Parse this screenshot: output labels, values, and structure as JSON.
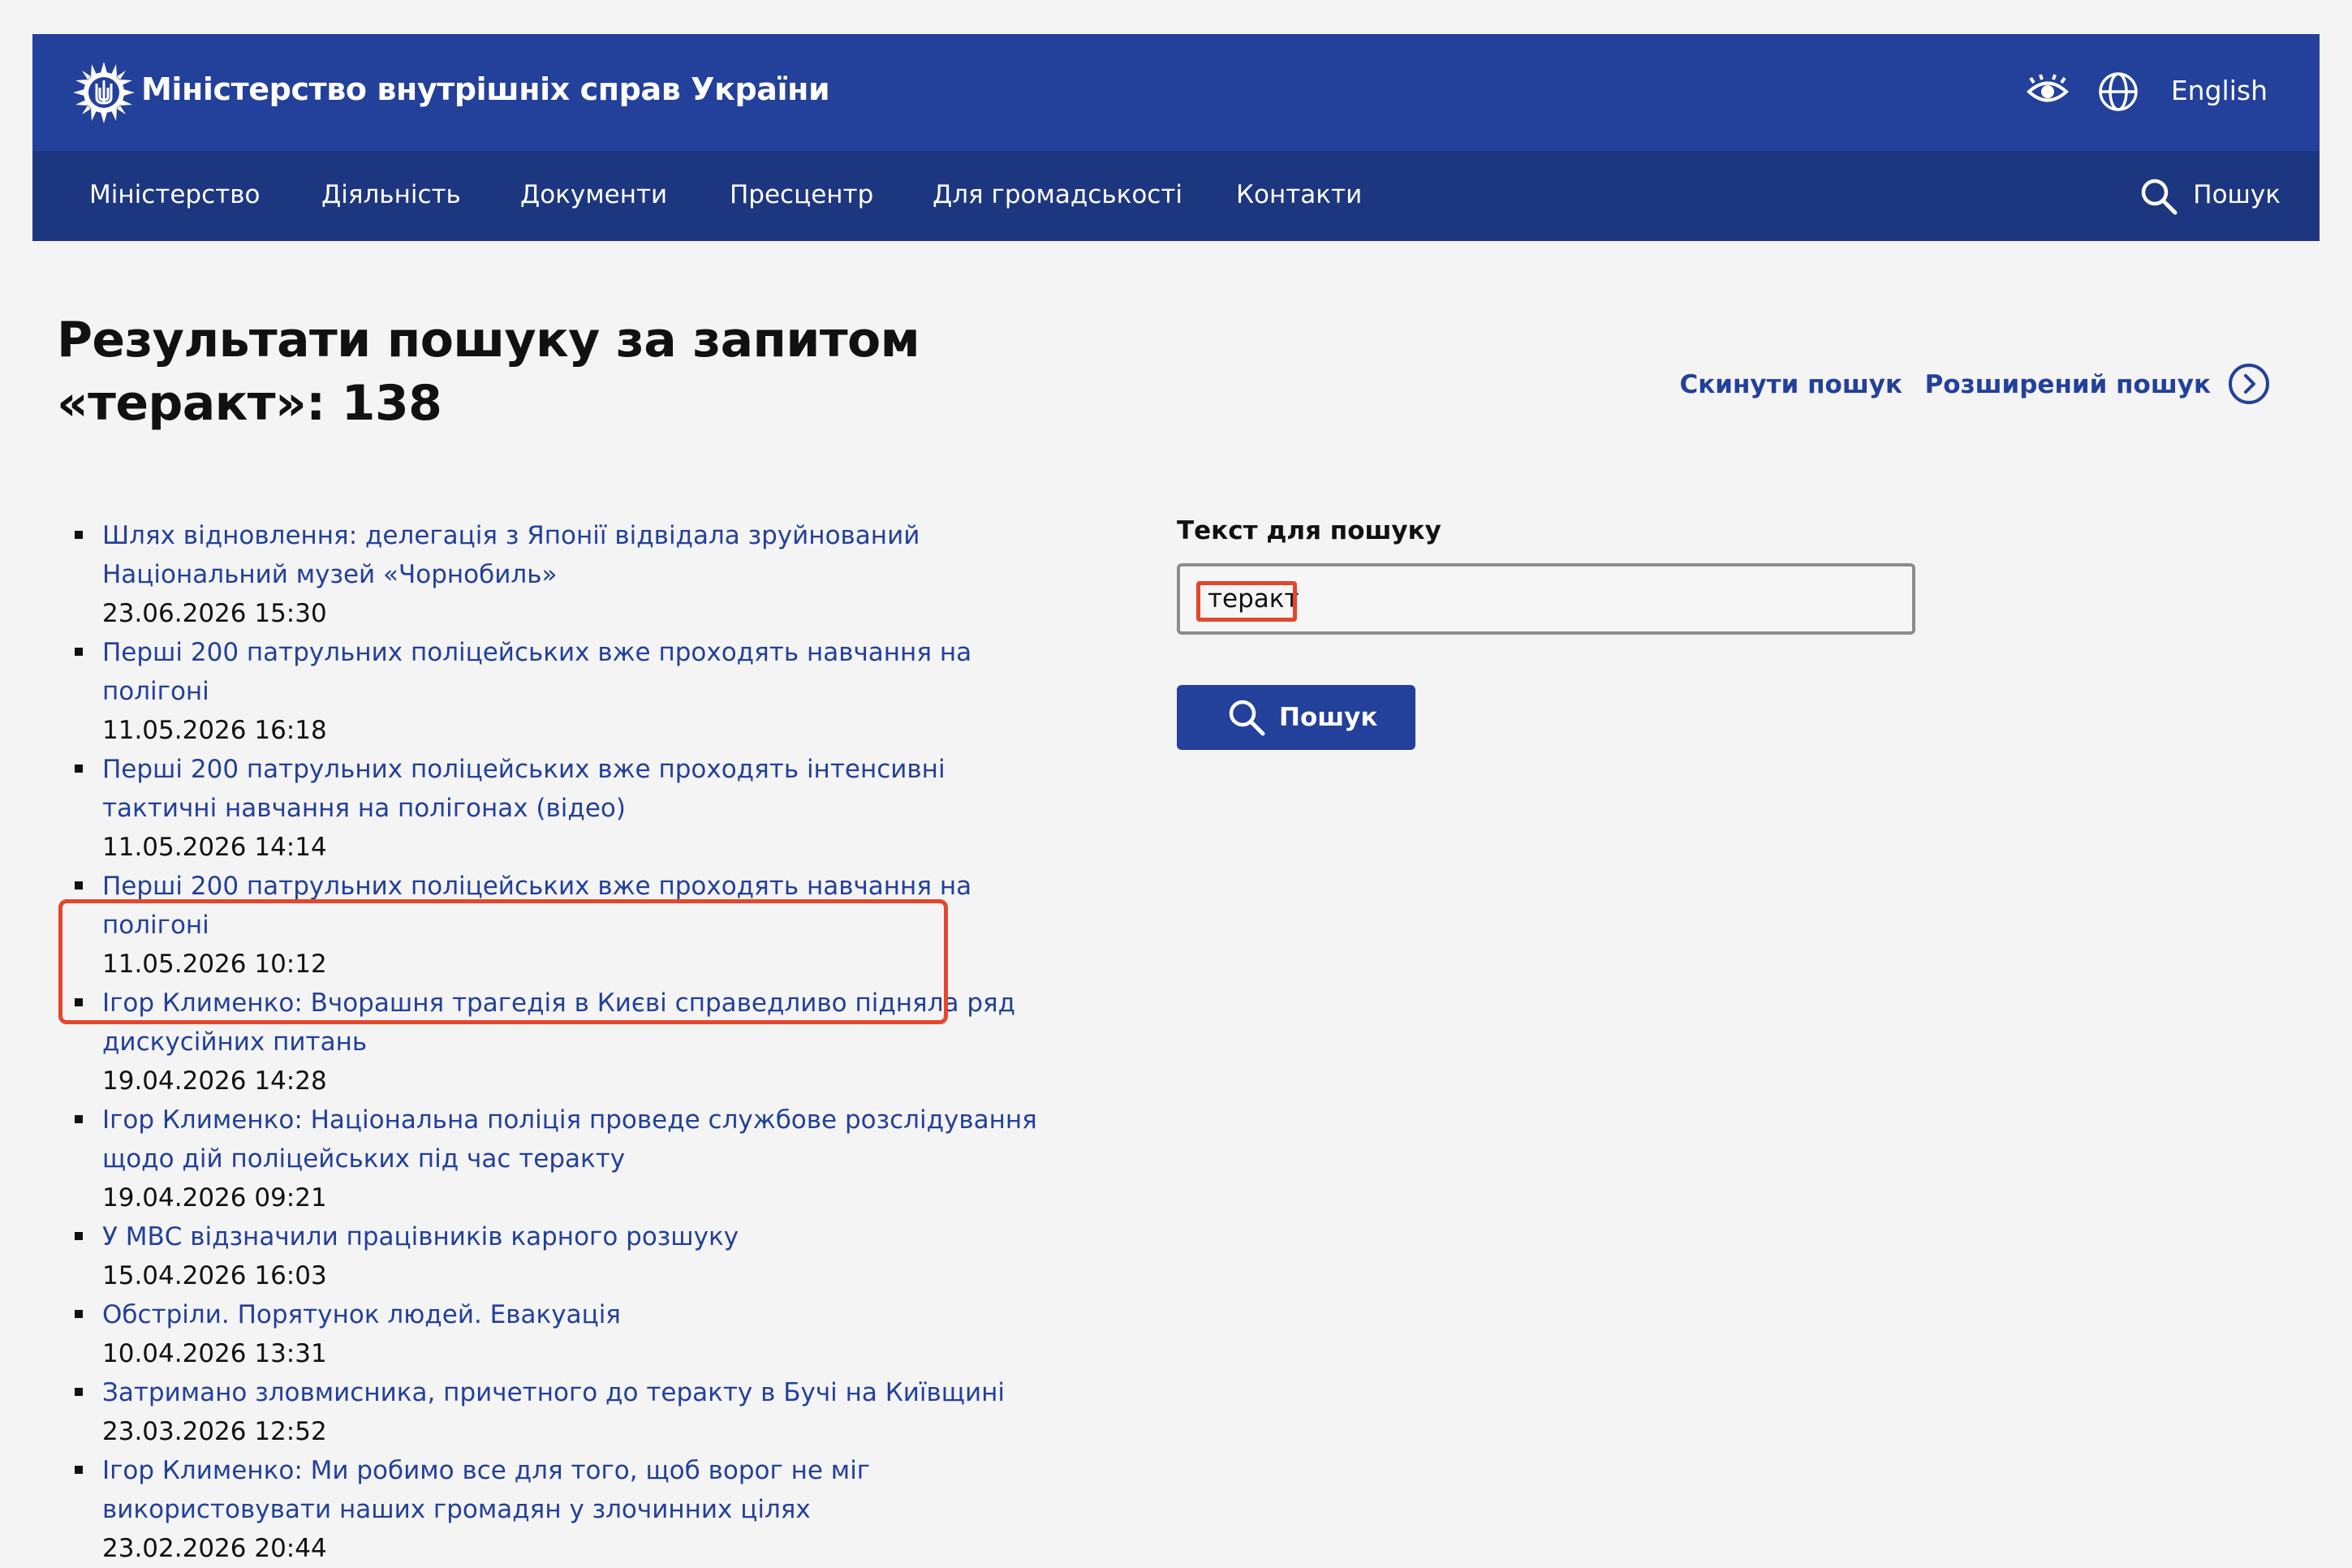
{
  "header": {
    "site_title": "Міністерство внутрішніх справ України",
    "language_link": "English",
    "nav": [
      {
        "label": "Міністерство"
      },
      {
        "label": "Діяльність"
      },
      {
        "label": "Документи"
      },
      {
        "label": "Пресцентр"
      },
      {
        "label": "Для громадськості"
      },
      {
        "label": "Контакти"
      }
    ],
    "search_label": "Пошук"
  },
  "page": {
    "title": "Результати пошуку за запитом «теракт»: 138",
    "reset_search": "Скинути пошук",
    "advanced_search": "Розширений пошук"
  },
  "results": [
    {
      "title": "Шлях відновлення: делегація з Японії відвідала зруйнований Національний музей «Чорнобиль»",
      "date": "23.06.2026 15:30"
    },
    {
      "title": "Перші 200 патрульних поліцейських вже проходять навчання на полігоні",
      "date": "11.05.2026 16:18"
    },
    {
      "title": "Перші 200 патрульних поліцейських вже проходять інтенсивні тактичні навчання на полігонах (відео)",
      "date": "11.05.2026 14:14"
    },
    {
      "title": "Перші 200 патрульних поліцейських вже проходять навчання на полігоні",
      "date": "11.05.2026 10:12"
    },
    {
      "title": "Ігор Клименко: Вчорашня трагедія в Києві справедливо підняла ряд дискусійних питань",
      "date": "19.04.2026 14:28"
    },
    {
      "title": "Ігор Клименко: Національна поліція проведе службове розслідування щодо дій поліцейських під час теракту",
      "date": "19.04.2026 09:21"
    },
    {
      "title": "У МВС відзначили працівників карного розшуку",
      "date": "15.04.2026 16:03"
    },
    {
      "title": "Обстріли. Порятунок людей. Евакуація",
      "date": "10.04.2026 13:31"
    },
    {
      "title": "Затримано зловмисника, причетного до теракту в Бучі на Київщині",
      "date": "23.03.2026 12:52"
    },
    {
      "title": "Ігор Клименко: Ми робимо все для того, щоб ворог не міг використовувати наших громадян у злочинних цілях",
      "date": "23.02.2026 20:44"
    }
  ],
  "search_form": {
    "label": "Текст для пошуку",
    "value": "теракт",
    "button_label": "Пошук"
  },
  "colors": {
    "brand_blue": "#23409a",
    "nav_blue": "#1d3680",
    "highlight_red": "#e4472c"
  }
}
